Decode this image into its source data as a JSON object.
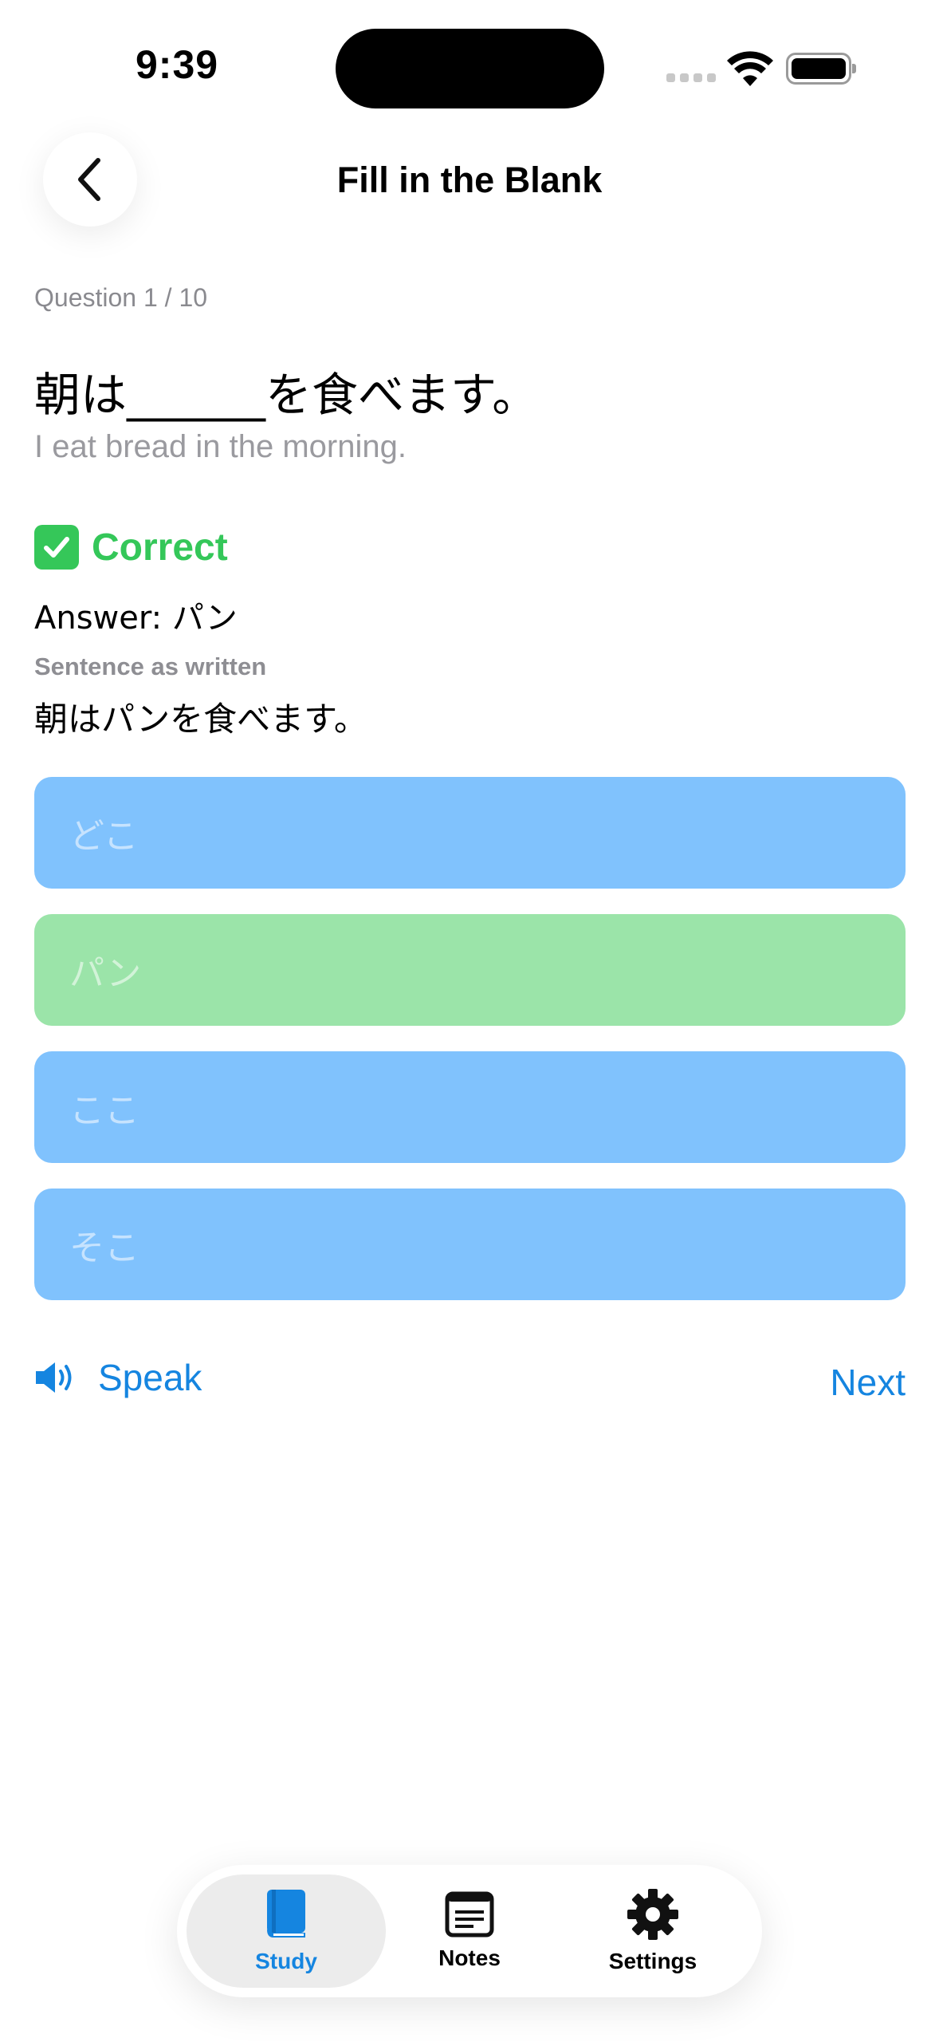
{
  "status": {
    "time": "9:39"
  },
  "nav": {
    "title": "Fill in the Blank",
    "back_icon": "chevron-left-icon"
  },
  "quiz": {
    "counter": "Question 1 / 10",
    "sentence": "朝は______を食べます。",
    "translation": "I eat bread in the morning.",
    "result_icon": "check-mark-icon",
    "result_label": "Correct",
    "answer": "Answer: パン",
    "written_label": "Sentence as written",
    "written_sentence": "朝はパンを食べます。",
    "options": [
      {
        "label": "どこ",
        "state": "default"
      },
      {
        "label": "パン",
        "state": "correct"
      },
      {
        "label": "ここ",
        "state": "default"
      },
      {
        "label": "そこ",
        "state": "default"
      }
    ]
  },
  "actions": {
    "speak_label": "Speak",
    "next_label": "Next"
  },
  "tabs": [
    {
      "label": "Study",
      "icon": "book-icon",
      "active": true
    },
    {
      "label": "Notes",
      "icon": "notes-icon",
      "active": false
    },
    {
      "label": "Settings",
      "icon": "gear-icon",
      "active": false
    }
  ],
  "colors": {
    "accent": "#1585e0",
    "correct": "#34c759",
    "option_default": "#80c2fd",
    "option_correct": "#9be4a9"
  }
}
